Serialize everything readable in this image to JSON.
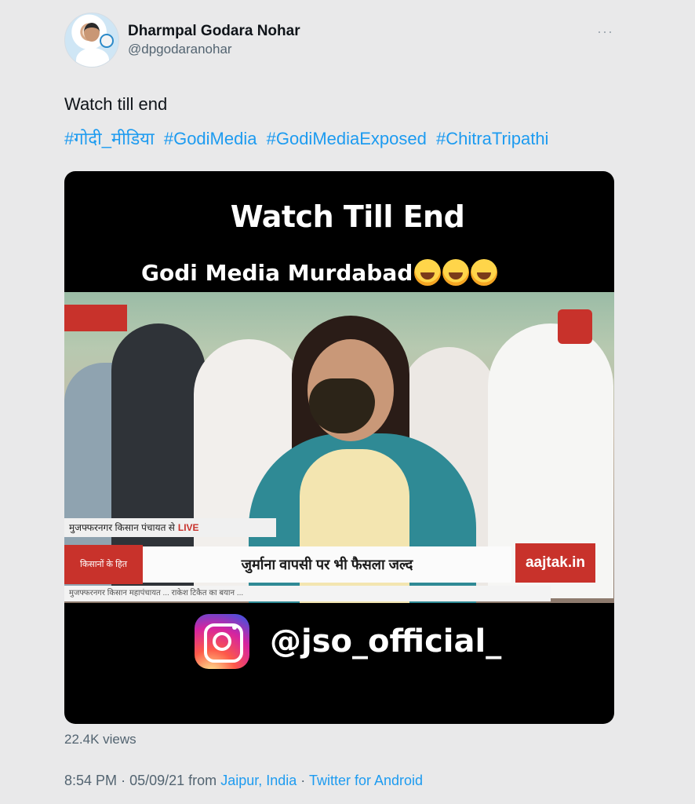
{
  "author": {
    "display_name": "Dharmpal Godara Nohar",
    "handle": "@dpgodaranohar"
  },
  "tweet": {
    "text": "Watch till end",
    "hashtags": [
      "#गोदी_मीडिया",
      "#GodiMedia",
      "#GodiMediaExposed",
      "#ChitraTripathi"
    ]
  },
  "video": {
    "title": "Watch Till End",
    "subtitle": "Godi Media Murdabad",
    "live_strip": "मुजफ्फरनगर किसान पंचायत से",
    "live_label": "LIVE",
    "ticker_left": "किसानों के हित",
    "ticker_main": "जुर्माना वापसी पर भी फैसला जल्द",
    "ticker_right": "aajtak.in",
    "crawl": "मुजफ्फरनगर किसान महापंचायत ... राकेश टिकैत का बयान ...",
    "instagram_handle": "@jso_official_"
  },
  "stats": {
    "views": "22.4K views"
  },
  "meta": {
    "time": "8:54 PM",
    "date": "05/09/21",
    "from_label": "from",
    "location": "Jaipur, India",
    "source": "Twitter for Android",
    "separator": "·"
  },
  "icons": {
    "more": "more-icon",
    "instagram": "instagram-icon"
  }
}
